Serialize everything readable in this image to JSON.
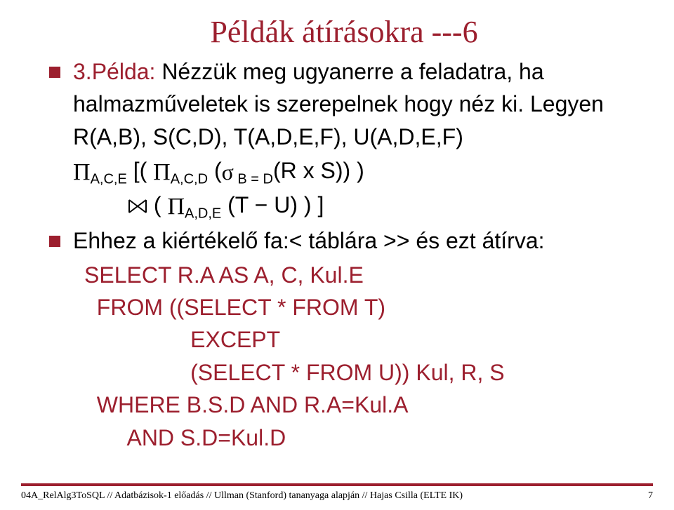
{
  "title": "Példák átírásokra ---6",
  "bullet1": {
    "lead": "3.Példa: ",
    "rest": "Nézzük meg ugyanerre a feladatra, ha halmazműveletek is szerepelnek hogy néz ki. Legyen R(A,B), S(C,D), T(A,D,E,F), U(A,D,E,F)"
  },
  "expr": {
    "line1_prefix_sub": "A,C,E",
    "line1_mid_sub": "A,C,D",
    "sigma_sub": " B = D",
    "line1_tail": "(R x S)) )",
    "line2_prefix": "( ",
    "line2_sub": "A,D,E",
    "line2_tail": "(T − U) ) ]",
    "minus_glyph": "−"
  },
  "bullet2": {
    "text": "Ehhez a kiértékelő fa:< táblára >> és ezt átírva:"
  },
  "query": {
    "l1": "SELECT R.A AS A, C, Kul.E",
    "l2": "  FROM ((SELECT * FROM T)",
    "l3": "                 EXCEPT",
    "l4": "                 (SELECT * FROM U)) Kul, R, S",
    "l5": "  WHERE B.S.D AND R.A=Kul.A",
    "l6": "       AND S.D=Kul.D"
  },
  "footer": {
    "left": "04A_RelAlg3ToSQL // Adatbázisok-1 előadás // Ullman (Stanford) tananyaga alapján // Hajas Csilla (ELTE IK)",
    "page": "7"
  }
}
